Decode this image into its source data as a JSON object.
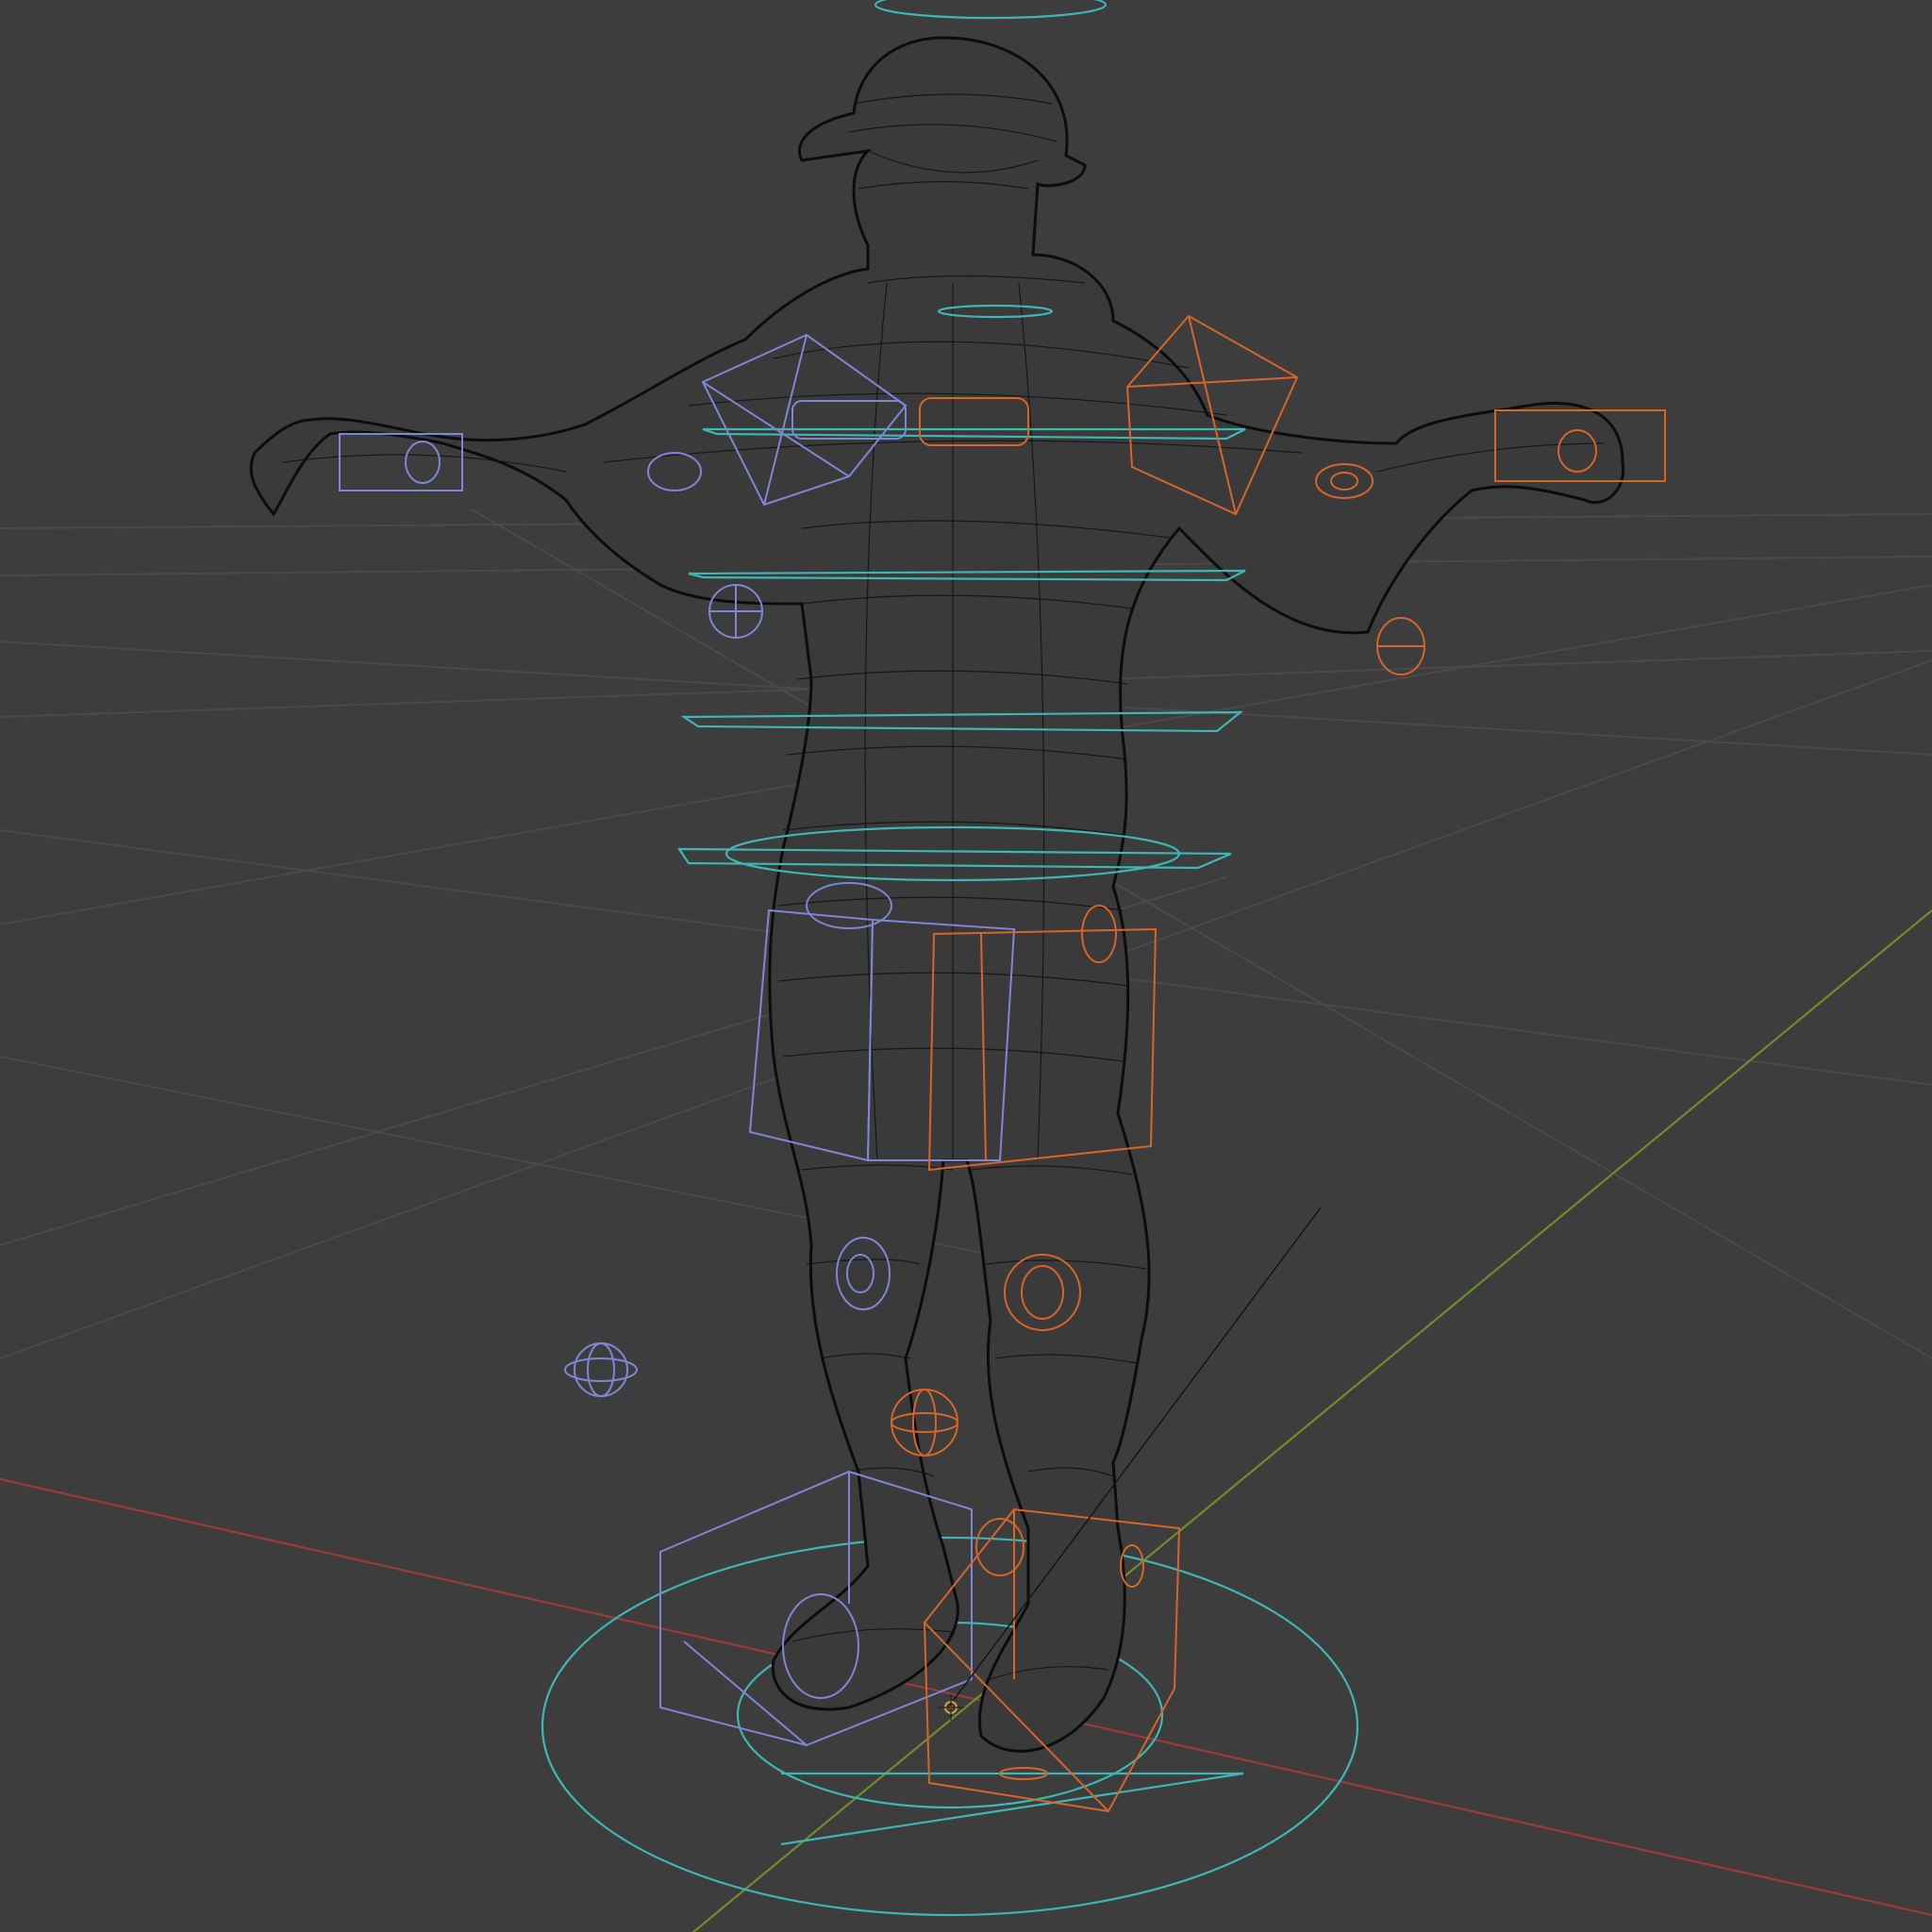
{
  "viewport": {
    "background": "#3d3d3d",
    "shading": "wireframe"
  },
  "colors": {
    "grid": "#4a4a4a",
    "x_axis": "#9b3b3b",
    "y_axis": "#6e8e2b",
    "mesh_wire": "#111111",
    "control_root": "#3fb6b6",
    "control_left": "#7f86d6",
    "control_right": "#d6652a"
  },
  "objects": {
    "character_mesh": {
      "icon": "mesh-icon"
    },
    "rig_controls": {
      "icon": "armature-icon"
    },
    "scene_origin": {
      "icon": "origin-icon"
    }
  }
}
